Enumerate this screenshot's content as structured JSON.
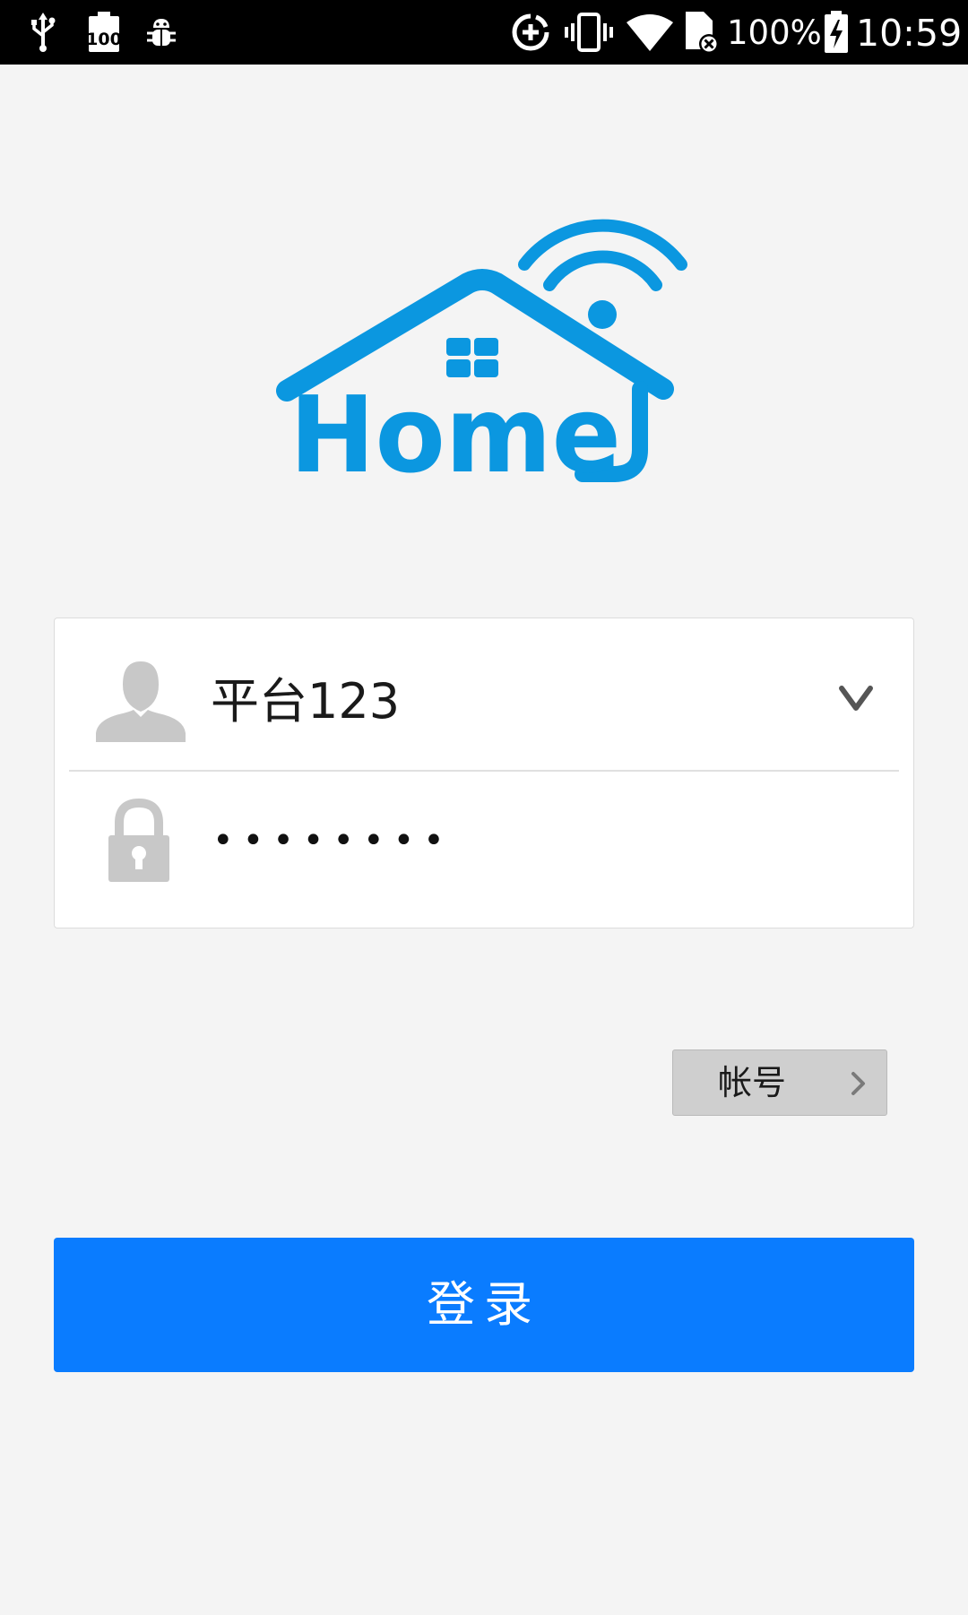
{
  "status_bar": {
    "battery_percent": "100%",
    "time": "10:59",
    "left_icons": [
      "usb-icon",
      "battery-100-icon",
      "debug-bug-icon"
    ],
    "right_icons": [
      "data-saver-icon",
      "vibrate-icon",
      "wifi-icon",
      "no-sim-icon",
      "battery-charging-icon"
    ]
  },
  "logo": {
    "icon": "home-wifi-logo",
    "text": "Home",
    "color": "#0b97e0"
  },
  "login_form": {
    "username": "平台123",
    "password_masked": "••••••••",
    "user_icon": "user-icon",
    "lock_icon": "lock-icon",
    "dropdown_icon": "chevron-down-icon"
  },
  "account_button": {
    "label": "帐号",
    "icon": "chevron-right-icon"
  },
  "login_button": {
    "label": "登录",
    "color": "#0a7cff"
  }
}
